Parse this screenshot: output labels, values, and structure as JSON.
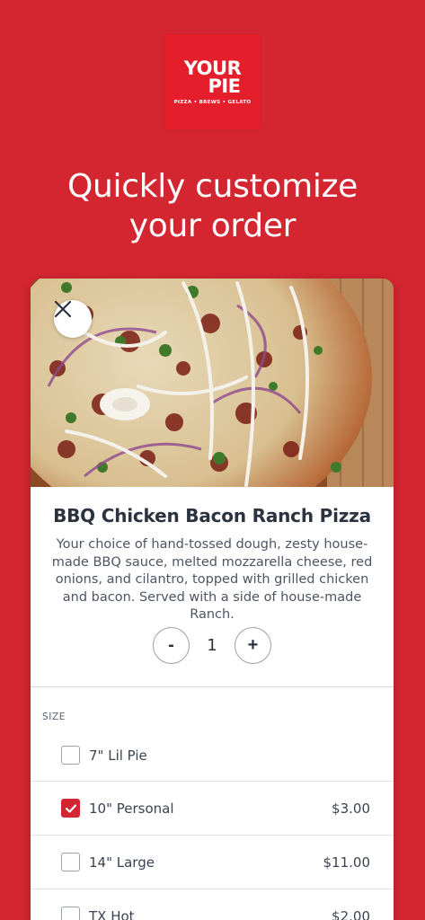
{
  "logo": {
    "word_top": "YOUR",
    "word_bottom": "PIE",
    "tagline": "PIZZA • BREWS • GELATO"
  },
  "headline": {
    "line1": "Quickly customize",
    "line2": "your order"
  },
  "item": {
    "title": "BBQ Chicken Bacon Ranch Pizza",
    "description": "Your choice of hand-tossed dough, zesty house-made BBQ sauce, melted mozzarella cheese, red onions, and cilantro, topped with grilled chicken and bacon. Served with a side of house-made Ranch.",
    "quantity": "1",
    "minus_label": "-",
    "plus_label": "+"
  },
  "size_section": {
    "label": "SIZE",
    "options": [
      {
        "label": "7\" Lil Pie",
        "price": "",
        "checked": false
      },
      {
        "label": "10\" Personal",
        "price": "$3.00",
        "checked": true
      },
      {
        "label": "14\" Large",
        "price": "$11.00",
        "checked": false
      },
      {
        "label": "TX Hot",
        "price": "$2.00",
        "checked": false
      }
    ]
  },
  "colors": {
    "brand_red": "#d42630",
    "text_dark": "#2b3340"
  },
  "icons": {
    "close": "close-icon",
    "checkmark": "checkmark-icon"
  }
}
